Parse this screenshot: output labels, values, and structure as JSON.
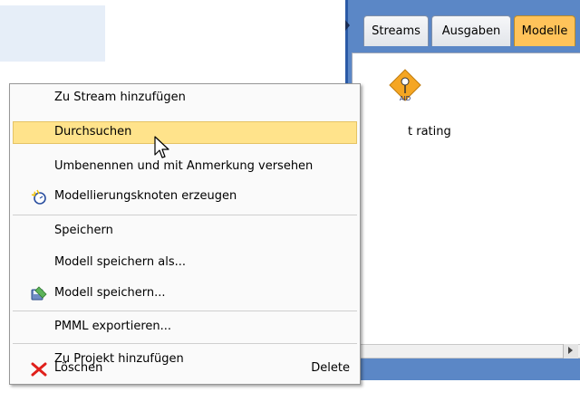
{
  "tabs": [
    "Streams",
    "Ausgaben",
    "Modelle"
  ],
  "active_tab": "Modelle",
  "node": {
    "label": "t rating",
    "icon": "chaid-model-icon"
  },
  "menu": {
    "items": [
      {
        "label": "Zu Stream hinzufügen",
        "highlighted": false
      },
      {
        "label": "Durchsuchen",
        "highlighted": true
      },
      {
        "label": "Umbenennen und mit Anmerkung versehen",
        "highlighted": false
      },
      {
        "label": "Modellierungsknoten erzeugen",
        "icon": "generate-node-icon",
        "highlighted": false
      },
      {
        "label": "Speichern",
        "highlighted": false
      },
      {
        "label": "Modell speichern als...",
        "highlighted": false
      },
      {
        "label": "Modell speichern...",
        "icon": "save-model-icon",
        "highlighted": false
      },
      {
        "label": "PMML exportieren...",
        "highlighted": false
      },
      {
        "label": "Zu Projekt hinzufügen",
        "highlighted": false
      },
      {
        "label": "Löschen",
        "icon": "delete-x-icon",
        "shortcut": "Delete",
        "highlighted": false
      }
    ]
  },
  "colors": {
    "highlight": "#ffe38b",
    "active_tab": "#ffc35a",
    "panel": "#5b87c6",
    "delete_icon": "#e0201b"
  }
}
